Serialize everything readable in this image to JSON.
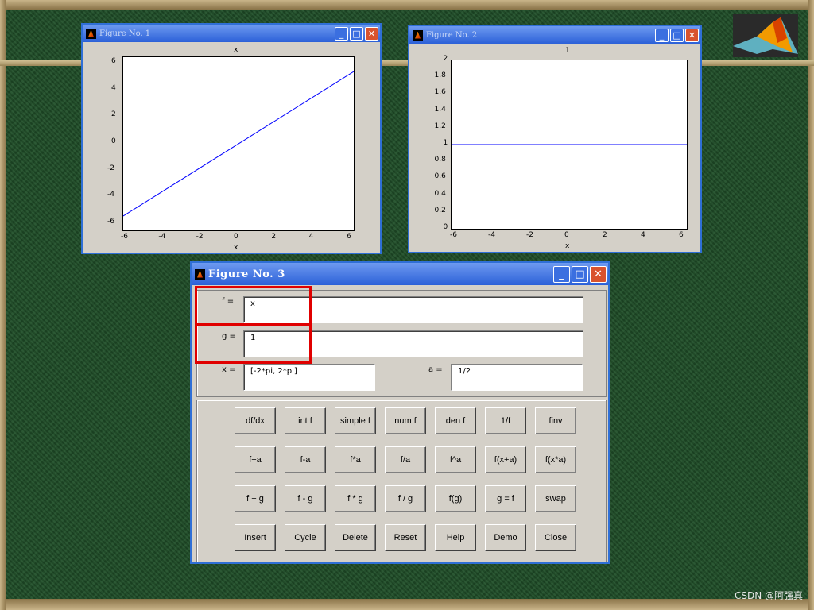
{
  "figure1": {
    "title": "Figure No. 1",
    "plot_title": "x",
    "xlabel": "x",
    "xticks": [
      "-6",
      "-4",
      "-2",
      "0",
      "2",
      "4",
      "6"
    ],
    "yticks": [
      "6",
      "4",
      "2",
      "0",
      "-2",
      "-4",
      "-6"
    ]
  },
  "figure2": {
    "title": "Figure No. 2",
    "plot_title": "1",
    "xlabel": "x",
    "xticks": [
      "-6",
      "-4",
      "-2",
      "0",
      "2",
      "4",
      "6"
    ],
    "yticks": [
      "2",
      "1.8",
      "1.6",
      "1.4",
      "1.2",
      "1",
      "0.8",
      "0.6",
      "0.4",
      "0.2",
      "0"
    ]
  },
  "figure3": {
    "title": "Figure No. 3",
    "f_label": "f =",
    "f_value": "x",
    "g_label": "g =",
    "g_value": "1",
    "x_label": "x =",
    "x_value": "[-2*pi, 2*pi]",
    "a_label": "a =",
    "a_value": "1/2",
    "buttons": [
      [
        "df/dx",
        "int f",
        "simple f",
        "num f",
        "den f",
        "1/f",
        "finv"
      ],
      [
        "f+a",
        "f-a",
        "f*a",
        "f/a",
        "f^a",
        "f(x+a)",
        "f(x*a)"
      ],
      [
        "f + g",
        "f - g",
        "f * g",
        "f / g",
        "f(g)",
        "g = f",
        "swap"
      ],
      [
        "Insert",
        "Cycle",
        "Delete",
        "Reset",
        "Help",
        "Demo",
        "Close"
      ]
    ]
  },
  "watermark": "CSDN @阿强真",
  "colors": {
    "title_bar": "#2b60d8",
    "close_button": "#d9532e",
    "highlight_box": "#e00000",
    "plot_line": "#0000ff",
    "board": "#21512a"
  }
}
